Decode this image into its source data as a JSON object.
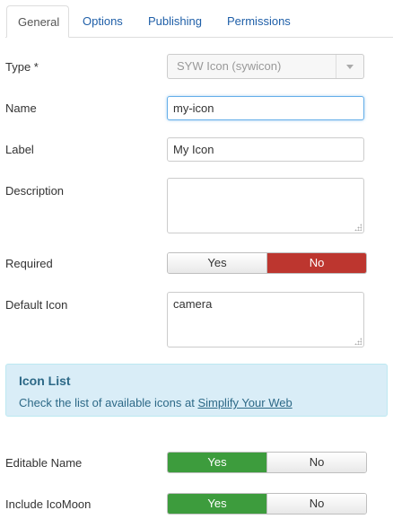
{
  "tabs": [
    {
      "label": "General",
      "active": true
    },
    {
      "label": "Options",
      "active": false
    },
    {
      "label": "Publishing",
      "active": false
    },
    {
      "label": "Permissions",
      "active": false
    }
  ],
  "form": {
    "type_label": "Type *",
    "type_value": "SYW Icon (sywicon)",
    "name_label": "Name",
    "name_value": "my-icon",
    "label_label": "Label",
    "label_value": "My Icon",
    "description_label": "Description",
    "description_value": "",
    "required_label": "Required",
    "required_yes": "Yes",
    "required_no": "No",
    "required_selected": "No",
    "default_icon_label": "Default Icon",
    "default_icon_value": "camera",
    "editable_name_label": "Editable Name",
    "editable_name_yes": "Yes",
    "editable_name_no": "No",
    "editable_name_selected": "Yes",
    "include_icomoon_label": "Include IcoMoon",
    "include_icomoon_yes": "Yes",
    "include_icomoon_no": "No",
    "include_icomoon_selected": "Yes"
  },
  "alert": {
    "title": "Icon List",
    "text": "Check the list of available icons at ",
    "link_text": "Simplify Your Web"
  },
  "icons": {
    "select_caret": "chevron-down-icon",
    "resize_grip": "resize-grip-icon"
  },
  "colors": {
    "tab_link": "#1f5fa8",
    "toggle_yes_active": "#3d9c3d",
    "toggle_no_active": "#bd362f",
    "alert_bg": "#d9edf7",
    "alert_text": "#2d6987",
    "focus_border": "#66afe9"
  }
}
